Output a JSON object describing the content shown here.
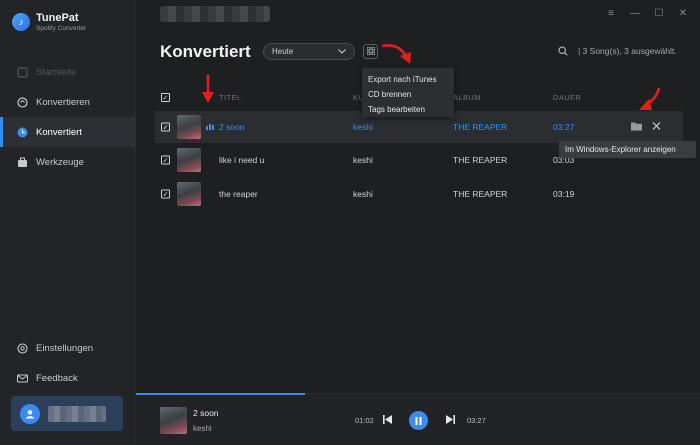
{
  "app": {
    "name": "TunePat",
    "subtitle": "Spotify Converter"
  },
  "nav": [
    {
      "label": "Startseite",
      "icon": "home-icon",
      "state": "disabled"
    },
    {
      "label": "Konvertieren",
      "icon": "convert-icon",
      "state": "normal"
    },
    {
      "label": "Konvertiert",
      "icon": "clock-icon",
      "state": "active"
    },
    {
      "label": "Werkzeuge",
      "icon": "toolbox-icon",
      "state": "normal"
    }
  ],
  "nav_bottom": [
    {
      "label": "Einstellungen",
      "icon": "gear-icon"
    },
    {
      "label": "Feedback",
      "icon": "mail-icon"
    }
  ],
  "header": {
    "title": "Konvertiert",
    "date_filter": "Heute",
    "count_text": "|   3 Song(s), 3 ausgewählt."
  },
  "menu": [
    "Export nach iTunes",
    "CD brennen",
    "Tags bearbeiten"
  ],
  "columns": {
    "title": "TITEL",
    "artist": "KÜNSTLER",
    "album": "ALBUM",
    "duration": "DAUER"
  },
  "rows": [
    {
      "title": "2 soon",
      "artist": "keshi",
      "album": "THE REAPER",
      "duration": "03:27",
      "selected": true
    },
    {
      "title": "like i need u",
      "artist": "keshi",
      "album": "THE REAPER",
      "duration": "03:03",
      "selected": false
    },
    {
      "title": "the reaper",
      "artist": "keshi",
      "album": "THE REAPER",
      "duration": "03:19",
      "selected": false
    }
  ],
  "tooltip": "Im Windows-Explorer anzeigen",
  "player": {
    "title": "2 soon",
    "artist": "keshi",
    "elapsed": "01:02",
    "total": "03:27",
    "progress": 0.3
  },
  "colors": {
    "accent": "#3a8cf0",
    "sidebar": "#232427",
    "background": "#1e1f21",
    "arrow": "#e02020"
  }
}
